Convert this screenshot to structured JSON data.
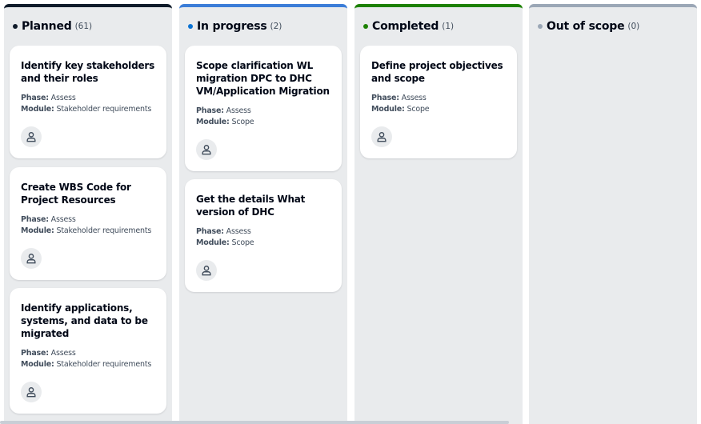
{
  "columns": [
    {
      "title": "Planned",
      "count": "(61)",
      "dot_color": "#0f1b2a",
      "cards": [
        {
          "title": "Identify key stakeholders and their roles",
          "phase_label": "Phase:",
          "phase": "Assess",
          "module_label": "Module:",
          "module": "Stakeholder requirements"
        },
        {
          "title": "Create WBS Code for Project Resources",
          "phase_label": "Phase:",
          "phase": "Assess",
          "module_label": "Module:",
          "module": "Stakeholder requirements"
        },
        {
          "title": "Identify applications, systems, and data to be migrated",
          "phase_label": "Phase:",
          "phase": "Assess",
          "module_label": "Module:",
          "module": "Stakeholder requirements"
        }
      ]
    },
    {
      "title": "In progress",
      "count": "(2)",
      "dot_color": "#0972d3",
      "cards": [
        {
          "title": "Scope clarification WL migration DPC to DHC VM/Application Migration",
          "phase_label": "Phase:",
          "phase": "Assess",
          "module_label": "Module:",
          "module": "Scope"
        },
        {
          "title": "Get the details What version of DHC",
          "phase_label": "Phase:",
          "phase": "Assess",
          "module_label": "Module:",
          "module": "Scope"
        }
      ]
    },
    {
      "title": "Completed",
      "count": "(1)",
      "dot_color": "#1d8102",
      "cards": [
        {
          "title": "Define project objectives and scope",
          "phase_label": "Phase:",
          "phase": "Assess",
          "module_label": "Module:",
          "module": "Scope"
        }
      ]
    },
    {
      "title": "Out of scope",
      "count": "(0)",
      "dot_color": "#9ba7b6",
      "cards": []
    }
  ],
  "icons": {
    "avatar": "user-icon"
  }
}
